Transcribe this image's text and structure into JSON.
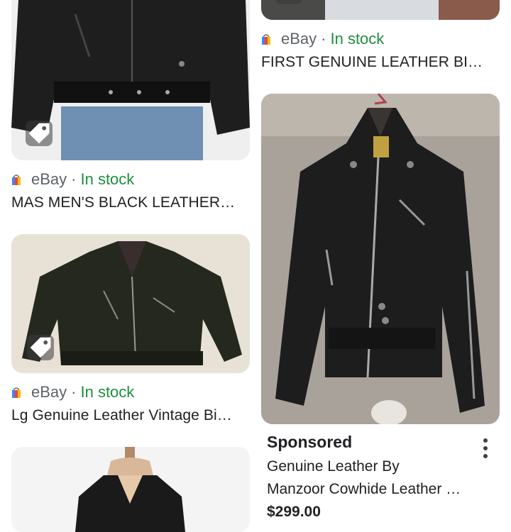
{
  "results": [
    {
      "source": "eBay",
      "separator": "·",
      "availability": "In stock",
      "title": "FIRST GENUINE LEATHER BIKER JACKET"
    },
    {
      "source": "eBay",
      "separator": "·",
      "availability": "In stock",
      "title": "MAS MEN'S BLACK LEATHER JACKET"
    },
    {
      "source": "eBay",
      "separator": "·",
      "availability": "In stock",
      "title": "Lg Genuine Leather Vintage Biker Jacket"
    }
  ],
  "sponsored": {
    "label": "Sponsored",
    "title_line1": "Genuine Leather By",
    "title_line2": "Manzoor Cowhide Leather Jacket",
    "price": "$299.00"
  },
  "icons": {
    "tag": "tag-icon",
    "store": "store-logo-icon",
    "more": "more-vert-icon"
  },
  "colors": {
    "in_stock": "#1e8e3e",
    "source_text": "#5f6368"
  }
}
